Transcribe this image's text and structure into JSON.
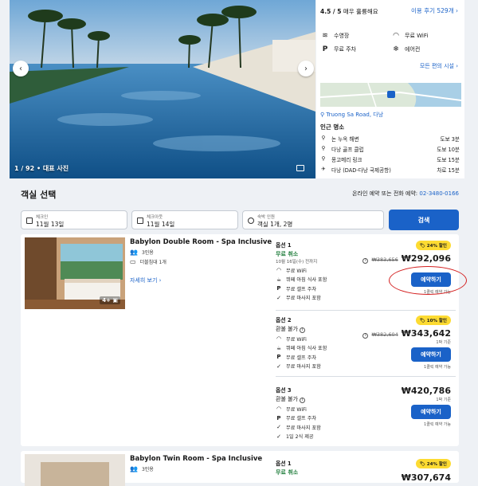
{
  "gallery": {
    "counter": "1 / 92",
    "counter_suffix": "• 대표 사진"
  },
  "rating": {
    "score": "4.5 / 5",
    "label": "매우 훌륭해요",
    "reviews_link": "이용 후기 529개"
  },
  "amenities": [
    {
      "icon": "pool-icon",
      "label": "수영장"
    },
    {
      "icon": "wifi-icon",
      "label": "무료 WiFi"
    },
    {
      "icon": "parking-icon",
      "label": "무료 주차"
    },
    {
      "icon": "ac-icon",
      "label": "에어컨"
    }
  ],
  "all_amenities_link": "모든 편의 시설",
  "address": "Truong Sa Road, 다낭",
  "nearby": {
    "title": "인근 명소",
    "items": [
      {
        "name": "논 누옥 해변",
        "distance": "도보 3분"
      },
      {
        "name": "다낭 골프 클럽",
        "distance": "도보 10분"
      },
      {
        "name": "몽고메리 링크",
        "distance": "도보 15분"
      },
      {
        "name": "다낭 (DAD-다낭 국제공항)",
        "distance": "차로 15분"
      }
    ]
  },
  "room_select": {
    "title": "객실 선택",
    "phone_label": "온라인 예약 또는 전화 예약:",
    "phone_number": "02-3480-0166",
    "checkin_label": "체크인",
    "checkin_value": "11월 13일",
    "checkout_label": "체크아웃",
    "checkout_value": "11월 14일",
    "guests_label": "숙박 인원",
    "guests_value": "객실 1개, 2명",
    "search_button": "검색"
  },
  "room1": {
    "name": "Babylon Double Room - Spa Inclusive",
    "capacity": "3인용",
    "bed": "더블침대 1개",
    "photos_badge": "4+",
    "details_link": "자세히 보기",
    "options": [
      {
        "title": "옵션 1",
        "cancel": "무료 취소",
        "cancel_until": "10월 16일(수) 전까지",
        "features": [
          "무료 WiFi",
          "뷔페 아침 식사 포함",
          "무료 셀프 주차",
          "무료 마사지 포함"
        ],
        "discount": "24% 할인",
        "old_price": "₩383,656",
        "price": "₩292,096",
        "price_note": "",
        "book": "예약하기",
        "book_note": "1클릭 예약 가능"
      },
      {
        "title": "옵션 2",
        "cancel": "환불 불가",
        "features": [
          "무료 WiFi",
          "뷔페 아침 식사 포함",
          "무료 셀프 주차",
          "무료 마사지 포함"
        ],
        "discount": "10% 할인",
        "old_price": "₩382,604",
        "price": "₩343,642",
        "price_note": "1박 기준",
        "book": "예약하기",
        "book_note": "1클릭 예약 가능"
      },
      {
        "title": "옵션 3",
        "cancel": "환불 불가",
        "features": [
          "무료 WiFi",
          "무료 셀프 주차",
          "무료 마사지 포함",
          "1일 2식 제공"
        ],
        "price": "₩420,786",
        "price_note": "1박 기준",
        "book": "예약하기",
        "book_note": "1클릭 예약 가능"
      }
    ]
  },
  "room2": {
    "name": "Babylon Twin Room - Spa Inclusive",
    "capacity": "3인용",
    "option_title": "옵션 1",
    "cancel": "무료 취소",
    "discount": "24% 할인",
    "price": "₩307,674"
  }
}
